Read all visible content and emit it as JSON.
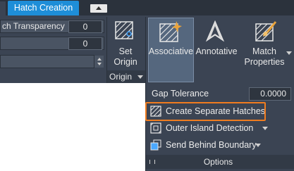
{
  "tabs": {
    "active": "Hatch Creation"
  },
  "properties_panel": {
    "transparency_label": "ch Transparency",
    "transparency_value": "0",
    "second_value": "0"
  },
  "origin_panel": {
    "set_origin_label_1": "Set",
    "set_origin_label_2": "Origin",
    "panel_title": "Origin"
  },
  "options_panel": {
    "associative_label": "Associative",
    "annotative_label": "Annotative",
    "match_properties_label_1": "Match",
    "match_properties_label_2": "Properties",
    "gap_tolerance_label": "Gap Tolerance",
    "gap_tolerance_value": "0.0000",
    "create_separate_hatches_label": "Create Separate Hatches",
    "outer_island_detection_label": "Outer Island Detection",
    "send_behind_boundary_label": "Send Behind Boundary",
    "panel_title": "Options"
  },
  "colors": {
    "active_tab": "#1e8ed8",
    "ribbon_bg": "#3b4453",
    "highlight": "#f07c1f",
    "icon_accent": "#e8a33c"
  },
  "icons": [
    "hatch-icon",
    "star-burst-icon",
    "annotative-icon",
    "match-properties-icon",
    "brush-icon",
    "island-detection-icon",
    "send-behind-icon"
  ]
}
